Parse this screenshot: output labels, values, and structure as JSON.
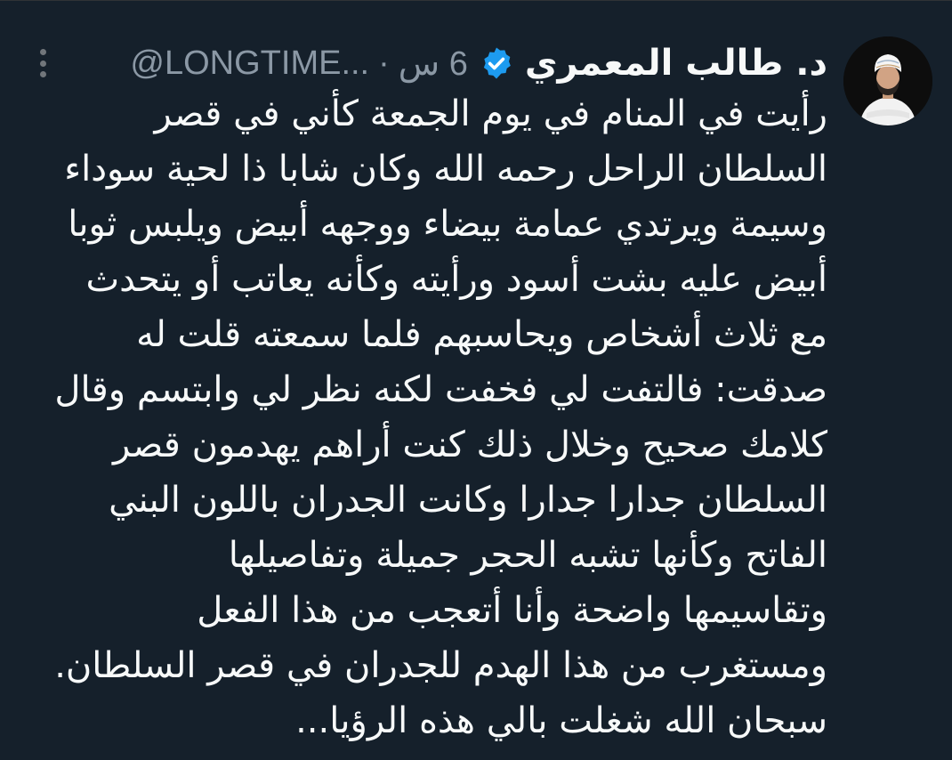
{
  "tweet": {
    "author": {
      "display_name": "د. طالب المعمري",
      "handle": "@LONGTIME...",
      "verified": true
    },
    "separator": "·",
    "time": "6 س",
    "more_icon": "more-dots-icon",
    "verified_icon": "verified-badge-icon",
    "colors": {
      "background": "#15202b",
      "text": "#f7f9f9",
      "secondary": "#8b98a5",
      "verified": "#1d9bf0"
    },
    "lines": [
      "رأيت في المنام في يوم الجمعة كأني في قصر",
      "السلطان الراحل رحمه الله وكان شابا ذا لحية سوداء",
      "وسيمة ويرتدي عمامة بيضاء ووجهه أبيض ويلبس ثوبا",
      "أبيض عليه بشت أسود ورأيته وكأنه يعاتب أو يتحدث",
      "مع ثلاث أشخاص ويحاسبهم فلما سمعته قلت له",
      "صدقت: فالتفت لي فخفت لكنه نظر لي وابتسم وقال",
      "كلامك صحيح وخلال ذلك كنت أراهم يهدمون قصر",
      "السلطان جدارا جدارا وكانت  الجدران باللون البني",
      "الفاتح وكأنها تشبه الحجر جميلة  وتفاصيلها",
      "وتقاسيمها واضحة  وأنا أتعجب من هذا الفعل",
      "ومستغرب من هذا الهدم للجدران في قصر السلطان.",
      "سبحان الله شغلت بالي هذه الرؤيا..."
    ]
  }
}
